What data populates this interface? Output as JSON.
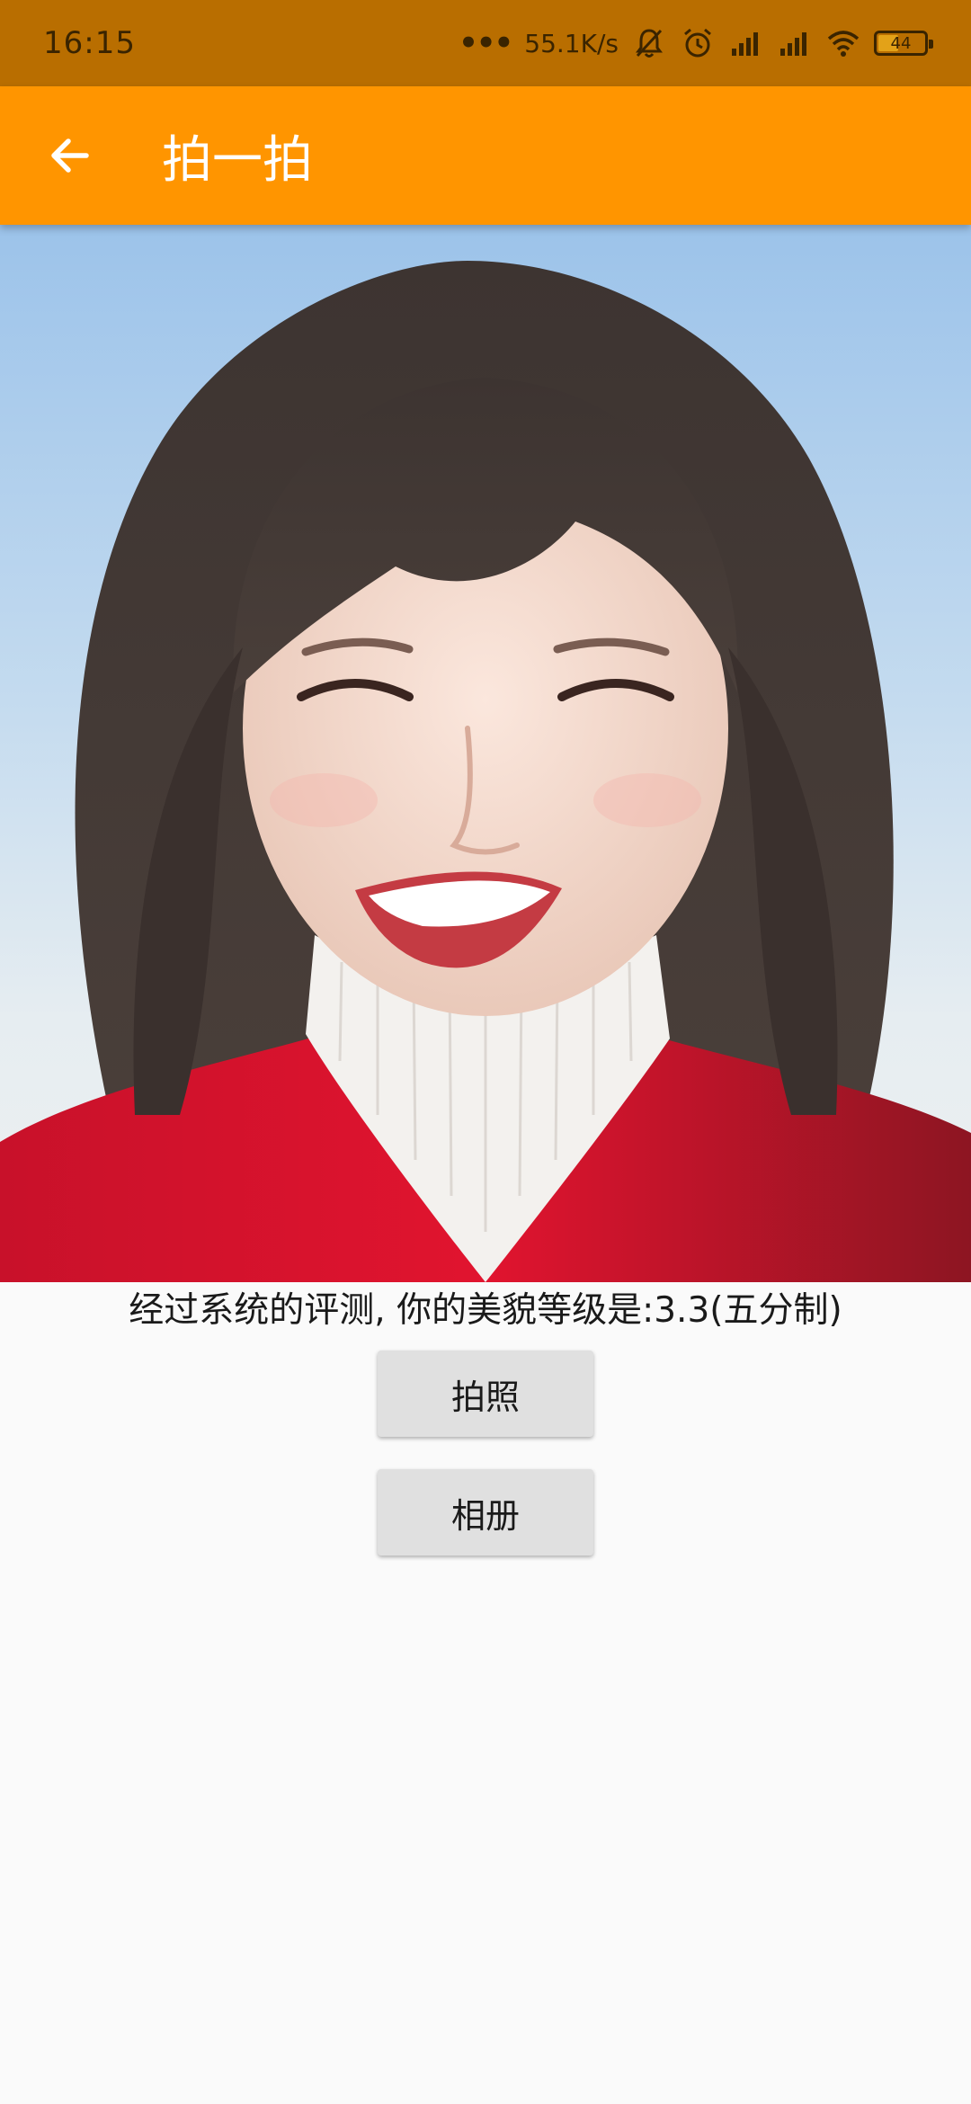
{
  "status_bar": {
    "time": "16:15",
    "net_speed": "55.1K/s",
    "battery_level": "44",
    "battery_fraction": 0.44
  },
  "app_bar": {
    "title": "拍一拍",
    "back_icon": "arrow-left-icon"
  },
  "main": {
    "photo_alt": "portrait-photo",
    "result_text": "经过系统的评测, 你的美貌等级是:3.3(五分制)",
    "score": 3.3,
    "buttons": {
      "take_photo": "拍照",
      "album": "相册"
    }
  },
  "colors": {
    "status_bar": "#b96e00",
    "app_bar": "#ff9500",
    "background": "#fafafa",
    "button": "#e0e0e0"
  }
}
